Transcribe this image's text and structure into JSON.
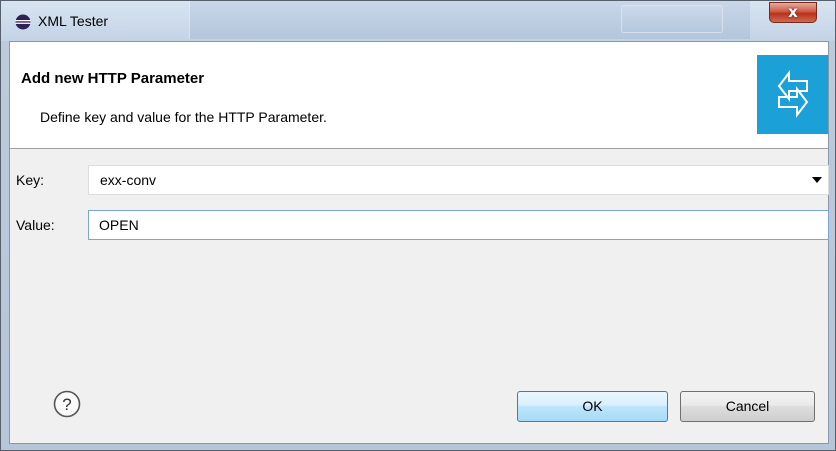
{
  "window": {
    "title": "XML Tester",
    "close_label": "x"
  },
  "header": {
    "title": "Add new HTTP Parameter",
    "description": "Define key and value for the HTTP Parameter."
  },
  "form": {
    "key_label": "Key:",
    "key_value": "exx-conv",
    "value_label": "Value:",
    "value_value": "OPEN"
  },
  "buttons": {
    "ok": "OK",
    "cancel": "Cancel"
  },
  "icons": {
    "app": "eclipse-icon",
    "banner": "wizard-arrows-icon",
    "help": "help-icon",
    "dropdown": "chevron-down-icon"
  },
  "colors": {
    "banner": "#1ba0d8",
    "close": "#c8472f",
    "ok_border": "#3c7fb1"
  }
}
